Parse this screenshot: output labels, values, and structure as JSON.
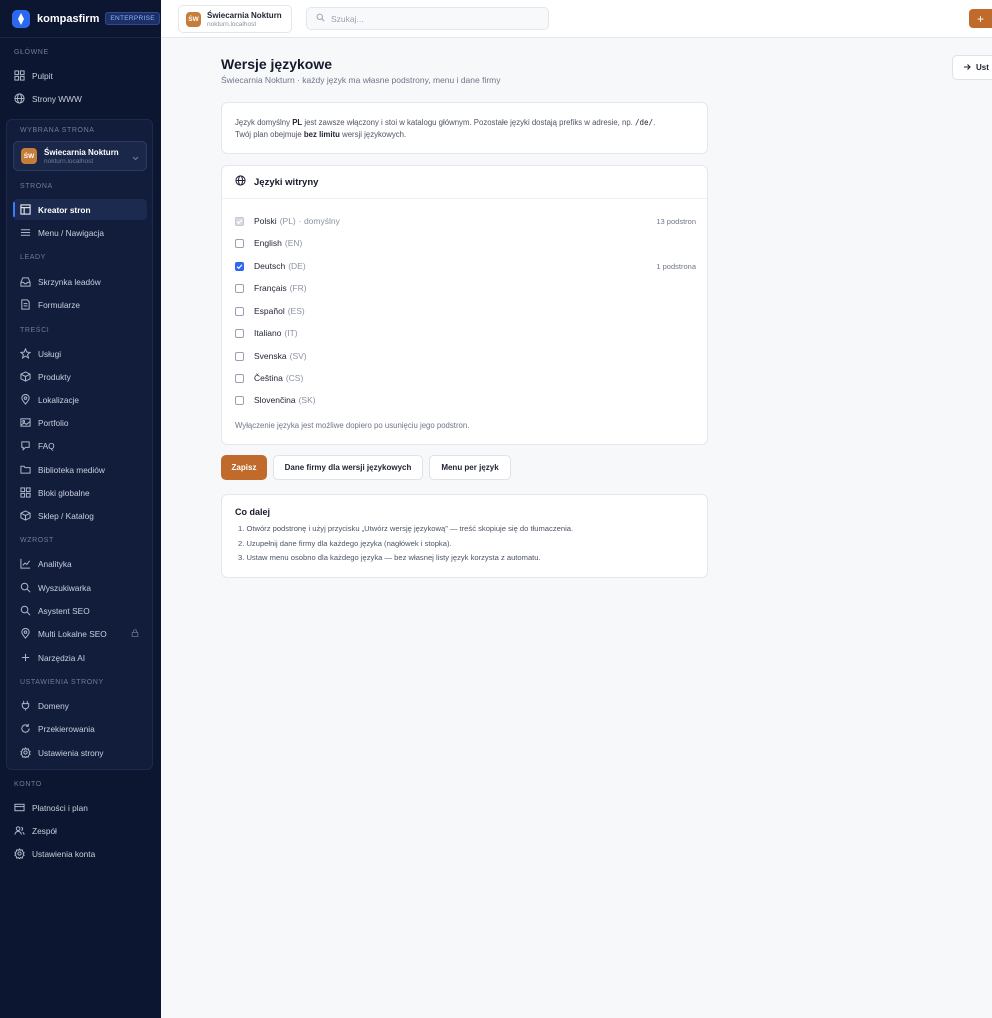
{
  "brand": {
    "name": "kompasfirm",
    "badge": "ENTERPRISE"
  },
  "sidebar": {
    "sections": {
      "main": "GŁÓWNE",
      "selected_site": "WYBRANA STRONA",
      "site": "STRONA",
      "leads": "LEADY",
      "content": "TREŚCI",
      "growth": "WZROST",
      "site_settings": "USTAWIENIA STRONY",
      "account": "KONTO"
    },
    "main_items": [
      {
        "label": "Pulpit",
        "icon": "grid-icon"
      },
      {
        "label": "Strony WWW",
        "icon": "globe-icon"
      }
    ],
    "site_card": {
      "avatar": "ŚW",
      "title": "Świecarnia Nokturn",
      "sub": "nokturn.localhost"
    },
    "site_items": [
      {
        "label": "Kreator stron",
        "icon": "layout-icon",
        "active": true
      },
      {
        "label": "Menu / Nawigacja",
        "icon": "menu-icon"
      }
    ],
    "lead_items": [
      {
        "label": "Skrzynka leadów",
        "icon": "inbox-icon"
      },
      {
        "label": "Formularze",
        "icon": "form-icon"
      }
    ],
    "content_items": [
      {
        "label": "Usługi",
        "icon": "star-icon"
      },
      {
        "label": "Produkty",
        "icon": "box-icon"
      },
      {
        "label": "Lokalizacje",
        "icon": "pin-icon"
      },
      {
        "label": "Portfolio",
        "icon": "image-icon"
      },
      {
        "label": "FAQ",
        "icon": "help-icon"
      },
      {
        "label": "Biblioteka mediów",
        "icon": "folder-icon"
      },
      {
        "label": "Bloki globalne",
        "icon": "blocks-icon"
      },
      {
        "label": "Sklep / Katalog",
        "icon": "shop-icon"
      }
    ],
    "growth_items": [
      {
        "label": "Analityka",
        "icon": "chart-icon"
      },
      {
        "label": "Wyszukiwarka",
        "icon": "search-icon"
      },
      {
        "label": "Asystent SEO",
        "icon": "search-icon"
      },
      {
        "label": "Multi Lokalne SEO",
        "icon": "pin-icon",
        "locked": true
      },
      {
        "label": "Narzędzia AI",
        "icon": "sparkle-icon"
      }
    ],
    "settings_items": [
      {
        "label": "Domeny",
        "icon": "plug-icon"
      },
      {
        "label": "Przekierowania",
        "icon": "redirect-icon"
      },
      {
        "label": "Ustawienia strony",
        "icon": "gear-icon"
      }
    ],
    "account_items": [
      {
        "label": "Płatności i plan",
        "icon": "card-icon"
      },
      {
        "label": "Zespół",
        "icon": "users-icon"
      },
      {
        "label": "Ustawienia konta",
        "icon": "gear-icon"
      }
    ]
  },
  "topbar": {
    "site": {
      "avatar": "ŚW",
      "title": "Świecarnia Nokturn",
      "sub": "nokturn.localhost"
    },
    "search_placeholder": "Szukaj...",
    "plus_label": "+"
  },
  "page": {
    "title": "Wersje językowe",
    "subtitle": "Świecarnia Nokturn · każdy język ma własne podstrony, menu i dane firmy",
    "settings_button": "Ust"
  },
  "info": {
    "p1": "Język domyślny",
    "default_code": "PL",
    "p2": "jest zawsze włączony i stoi w katalogu głównym. Pozostałe języki dostają prefiks w adresie, np.",
    "prefix_example": "/de/",
    "p3": ".",
    "p4": "Twój plan obejmuje",
    "plan_limit": "bez limitu",
    "p5": "wersji językowych."
  },
  "languages": {
    "title": "Języki witryny",
    "items": [
      {
        "name": "Polski",
        "code": "(PL)",
        "suffix": "· domyślny",
        "state": "disabled",
        "count": "13 podstron"
      },
      {
        "name": "English",
        "code": "(EN)",
        "suffix": "",
        "state": "unchecked",
        "count": ""
      },
      {
        "name": "Deutsch",
        "code": "(DE)",
        "suffix": "",
        "state": "checked",
        "count": "1 podstrona"
      },
      {
        "name": "Français",
        "code": "(FR)",
        "suffix": "",
        "state": "unchecked",
        "count": ""
      },
      {
        "name": "Español",
        "code": "(ES)",
        "suffix": "",
        "state": "unchecked",
        "count": ""
      },
      {
        "name": "Italiano",
        "code": "(IT)",
        "suffix": "",
        "state": "unchecked",
        "count": ""
      },
      {
        "name": "Svenska",
        "code": "(SV)",
        "suffix": "",
        "state": "unchecked",
        "count": ""
      },
      {
        "name": "Čeština",
        "code": "(CS)",
        "suffix": "",
        "state": "unchecked",
        "count": ""
      },
      {
        "name": "Slovenčina",
        "code": "(SK)",
        "suffix": "",
        "state": "unchecked",
        "count": ""
      }
    ],
    "note": "Wyłączenie języka jest możliwe dopiero po usunięciu jego podstron."
  },
  "actions": {
    "save": "Zapisz",
    "company_data": "Dane firmy dla wersji językowych",
    "menu_per_lang": "Menu per język"
  },
  "next_steps": {
    "title": "Co dalej",
    "items": [
      "1. Otwórz podstronę i użyj przycisku „Utwórz wersję językową” — treść skopiuje się do tłumaczenia.",
      "2. Uzupełnij dane firmy dla każdego języka (nagłówek i stopka).",
      "3. Ustaw menu osobno dla każdego języka — bez własnej listy język korzysta z automatu."
    ]
  },
  "colors": {
    "sidebar_bg": "#0d1630",
    "accent": "#c06a2b",
    "brand_blue": "#2a68f0"
  }
}
